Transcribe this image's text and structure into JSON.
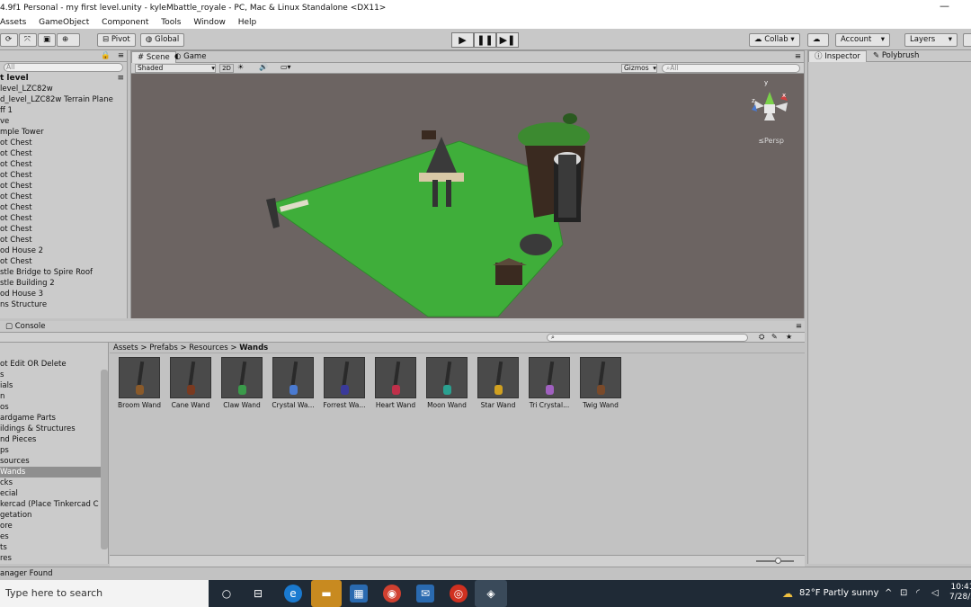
{
  "window": {
    "title": "4.9f1 Personal - my first level.unity - kyleMbattle_royale - PC, Mac & Linux Standalone <DX11>",
    "minimize": "—"
  },
  "menu": [
    "Assets",
    "GameObject",
    "Component",
    "Tools",
    "Window",
    "Help"
  ],
  "toolbar": {
    "pivot": "Pivot",
    "global": "Global",
    "collab": "Collab ▾",
    "account": "Account",
    "layers": "Layers"
  },
  "hierarchy": {
    "search_placeholder": "All",
    "scene_name": "t level",
    "items": [
      "level_LZC82w",
      "d_level_LZC82w Terrain Plane",
      "ff 1",
      "ve",
      "mple Tower",
      "ot Chest",
      "ot Chest",
      "ot Chest",
      "ot Chest",
      "ot Chest",
      "ot Chest",
      "ot Chest",
      "ot Chest",
      "ot Chest",
      "ot Chest",
      "od House 2",
      "ot Chest",
      "stle Bridge to Spire Roof",
      "stle Building 2",
      "od House 3",
      "ns Structure"
    ]
  },
  "scene": {
    "tabs": [
      "Scene",
      "Game"
    ],
    "shading": "Shaded",
    "mode2d": "2D",
    "gizmos": "Gizmos",
    "search_placeholder": "All",
    "persp": "≤Persp",
    "axes": {
      "y": "y",
      "x": "x",
      "z": "z"
    }
  },
  "inspector": {
    "tabs": [
      "Inspector",
      "Polybrush"
    ]
  },
  "console_tab": "Console",
  "project": {
    "breadcrumb": [
      "Assets",
      "Prefabs",
      "Resources",
      "Wands"
    ],
    "folders": [
      "ot Edit OR Delete",
      "s",
      "ials",
      "n",
      "os",
      "ardgame Parts",
      "ildings & Structures",
      "nd Pieces",
      "ps",
      "sources",
      "Wands",
      "cks",
      "ecial",
      "kercad (Place Tinkercad C",
      "getation",
      "ore",
      "es",
      "ts",
      "res"
    ],
    "selected_folder": "Wands",
    "assets": [
      {
        "name": "Broom Wand",
        "color": "#8a5a2a"
      },
      {
        "name": "Cane Wand",
        "color": "#7a3a20"
      },
      {
        "name": "Claw Wand",
        "color": "#3a9a4a"
      },
      {
        "name": "Crystal Wa...",
        "color": "#4a7ad0"
      },
      {
        "name": "Forrest Wa...",
        "color": "#3a3a9a"
      },
      {
        "name": "Heart Wand",
        "color": "#c0304a"
      },
      {
        "name": "Moon Wand",
        "color": "#2aa090"
      },
      {
        "name": "Star Wand",
        "color": "#d0a020"
      },
      {
        "name": "Tri Crystal...",
        "color": "#a060c0"
      },
      {
        "name": "Twig Wand",
        "color": "#7a4a2a"
      }
    ]
  },
  "status": "anager Found",
  "taskbar": {
    "search_placeholder": "Type here to search",
    "weather": "82°F  Partly sunny",
    "time": "10:41",
    "date": "7/28/2"
  }
}
